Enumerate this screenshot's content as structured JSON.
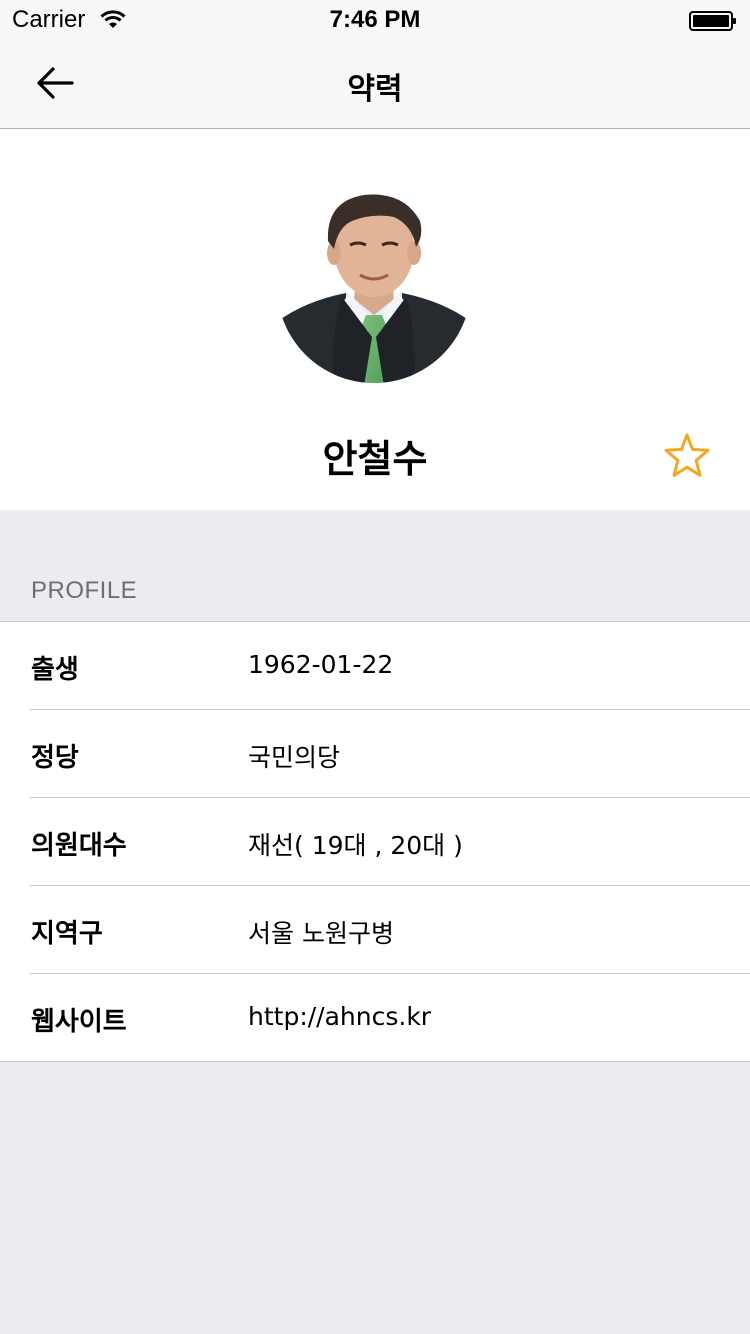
{
  "status_bar": {
    "carrier": "Carrier",
    "time": "7:46 PM",
    "wifi_icon": "wifi-icon",
    "battery_icon": "battery-icon"
  },
  "nav": {
    "title": "약력",
    "back_icon": "arrow-left-icon"
  },
  "profile_header": {
    "name": "안철수",
    "favorite_icon": "star-outline-icon",
    "favorite_color": "#f5a623"
  },
  "section": {
    "title": "PROFILE",
    "rows": [
      {
        "label": "출생",
        "value": "1962-01-22"
      },
      {
        "label": "정당",
        "value": "국민의당"
      },
      {
        "label": "의원대수",
        "value": "재선( 19대 , 20대 )"
      },
      {
        "label": "지역구",
        "value": "서울 노원구병"
      },
      {
        "label": "웹사이트",
        "value": "http://ahncs.kr"
      }
    ]
  },
  "colors": {
    "nav_background": "#f7f7f7",
    "page_background": "#ebebf1",
    "separator": "#c8c7cc",
    "section_header_text": "#6d6d72"
  }
}
